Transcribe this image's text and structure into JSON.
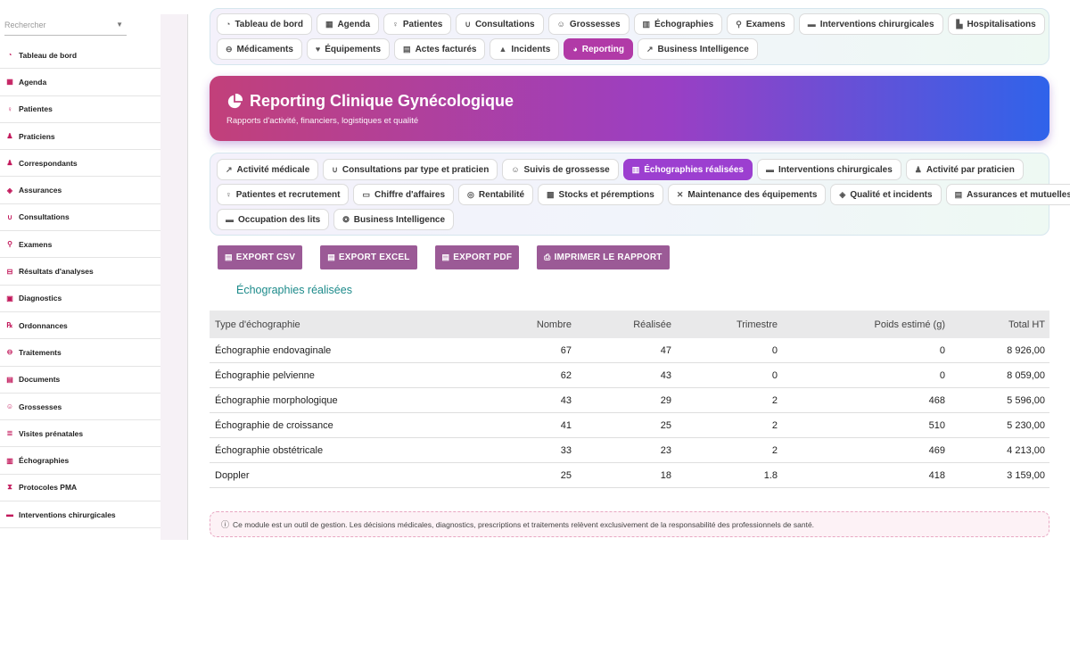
{
  "sidebar": {
    "search_placeholder": "Rechercher",
    "items": [
      {
        "label": "Tableau de bord",
        "icon": "dashboard-icon"
      },
      {
        "label": "Agenda",
        "icon": "calendar-icon"
      },
      {
        "label": "Patientes",
        "icon": "female-icon"
      },
      {
        "label": "Praticiens",
        "icon": "user-doctor-icon"
      },
      {
        "label": "Correspondants",
        "icon": "user-icon"
      },
      {
        "label": "Assurances",
        "icon": "shield-icon"
      },
      {
        "label": "Consultations",
        "icon": "stethoscope-icon"
      },
      {
        "label": "Examens",
        "icon": "microscope-icon"
      },
      {
        "label": "Résultats d'analyses",
        "icon": "vial-icon"
      },
      {
        "label": "Diagnostics",
        "icon": "clipboard-icon"
      },
      {
        "label": "Ordonnances",
        "icon": "prescription-icon"
      },
      {
        "label": "Traitements",
        "icon": "pills-icon"
      },
      {
        "label": "Documents",
        "icon": "file-icon"
      },
      {
        "label": "Grossesses",
        "icon": "baby-icon"
      },
      {
        "label": "Visites prénatales",
        "icon": "notes-icon"
      },
      {
        "label": "Échographies",
        "icon": "ultrasound-icon"
      },
      {
        "label": "Protocoles PMA",
        "icon": "dna-icon"
      },
      {
        "label": "Interventions chirurgicales",
        "icon": "bed-icon"
      }
    ]
  },
  "topnav": {
    "row1": [
      {
        "label": "Tableau de bord",
        "icon": "dashboard-icon"
      },
      {
        "label": "Agenda",
        "icon": "calendar-icon"
      },
      {
        "label": "Patientes",
        "icon": "female-icon"
      },
      {
        "label": "Consultations",
        "icon": "stethoscope-icon"
      },
      {
        "label": "Grossesses",
        "icon": "baby-icon"
      },
      {
        "label": "Échographies",
        "icon": "ultrasound-icon"
      },
      {
        "label": "Examens",
        "icon": "microscope-icon"
      },
      {
        "label": "Interventions chirurgicales",
        "icon": "bed-icon"
      },
      {
        "label": "Hospitalisations",
        "icon": "hospital-icon"
      }
    ],
    "row2": [
      {
        "label": "Médicaments",
        "icon": "pills-icon"
      },
      {
        "label": "Équipements",
        "icon": "heart-pulse-icon"
      },
      {
        "label": "Actes facturés",
        "icon": "invoice-icon"
      },
      {
        "label": "Incidents",
        "icon": "warning-icon"
      },
      {
        "label": "Reporting",
        "icon": "pie-chart-icon",
        "active": true
      },
      {
        "label": "Business Intelligence",
        "icon": "line-chart-icon"
      }
    ]
  },
  "hero": {
    "title": "Reporting Clinique Gynécologique",
    "subtitle": "Rapports d'activité, financiers, logistiques et qualité",
    "icon": "pie-chart-icon"
  },
  "subnav": {
    "row1": [
      {
        "label": "Activité médicale",
        "icon": "line-chart-icon"
      },
      {
        "label": "Consultations par type et praticien",
        "icon": "stethoscope-icon"
      },
      {
        "label": "Suivis de grossesse",
        "icon": "baby-icon"
      },
      {
        "label": "Échographies réalisées",
        "icon": "ultrasound-icon",
        "active": true
      },
      {
        "label": "Interventions chirurgicales",
        "icon": "bed-icon"
      },
      {
        "label": "Activité par praticien",
        "icon": "user-doctor-icon"
      }
    ],
    "row2": [
      {
        "label": "Patientes et recrutement",
        "icon": "female-icon"
      },
      {
        "label": "Chiffre d'affaires",
        "icon": "money-icon"
      },
      {
        "label": "Rentabilité",
        "icon": "coins-icon"
      },
      {
        "label": "Stocks et péremptions",
        "icon": "boxes-icon"
      },
      {
        "label": "Maintenance des équipements",
        "icon": "tools-icon"
      },
      {
        "label": "Qualité et incidents",
        "icon": "shield-icon"
      },
      {
        "label": "Assurances et mutuelles",
        "icon": "file-icon"
      }
    ],
    "row3": [
      {
        "label": "Occupation des lits",
        "icon": "bed-icon"
      },
      {
        "label": "Business Intelligence",
        "icon": "brain-icon"
      }
    ]
  },
  "exports": {
    "csv": "EXPORT CSV",
    "excel": "EXPORT EXCEL",
    "pdf": "EXPORT PDF",
    "print": "IMPRIMER LE RAPPORT"
  },
  "report": {
    "title": "Échographies réalisées",
    "columns": [
      "Type d'échographie",
      "Nombre",
      "Réalisée",
      "Trimestre",
      "Poids estimé (g)",
      "Total HT"
    ],
    "rows": [
      [
        "Échographie endovaginale",
        "67",
        "47",
        "0",
        "0",
        "8 926,00"
      ],
      [
        "Échographie pelvienne",
        "62",
        "43",
        "0",
        "0",
        "8 059,00"
      ],
      [
        "Échographie morphologique",
        "43",
        "29",
        "2",
        "468",
        "5 596,00"
      ],
      [
        "Échographie de croissance",
        "41",
        "25",
        "2",
        "510",
        "5 230,00"
      ],
      [
        "Échographie obstétricale",
        "33",
        "23",
        "2",
        "469",
        "4 213,00"
      ],
      [
        "Doppler",
        "25",
        "18",
        "1.8",
        "418",
        "3 159,00"
      ]
    ]
  },
  "disclaimer": "Ce module est un outil de gestion. Les décisions médicales, diagnostics, prescriptions et traitements relèvent exclusivement de la responsabilité des professionnels de santé.",
  "colors": {
    "accent": "#b13aa7",
    "sub_active": "#9c3fd0",
    "export_button": "#9b5a96",
    "section_title": "#1c8a8a"
  }
}
